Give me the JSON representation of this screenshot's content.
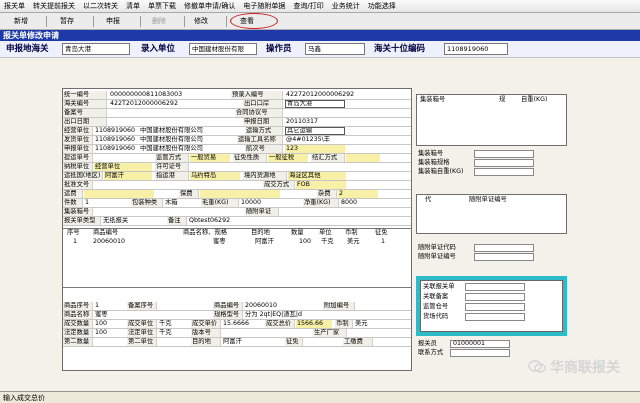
{
  "menu": [
    "报关单",
    "转关提前报关",
    "以二次转关",
    "清单",
    "单票下载",
    "修撤单申请/确认",
    "电子随附单据",
    "查询/打印",
    "业务统计",
    "功能选择"
  ],
  "toolbar": {
    "add": "新增",
    "save": "暂存",
    "declare": "申报",
    "delete": "删除",
    "modify": "修改",
    "view": "查看"
  },
  "title": "报关单修改申请",
  "header": {
    "customs_label": "申报地海关",
    "customs_value": "青岛大港",
    "unit_label": "录入单位",
    "unit_value": "中国建材股份有限",
    "operator_label": "操作员",
    "operator_value": "马鑫",
    "code_label": "海关十位编码",
    "code_value": "1108919060"
  },
  "form": {
    "unified_no_label": "统一编号",
    "unified_no": "000000000811083003",
    "pre_entry_label": "预录入编号",
    "pre_entry": "42272012000006292",
    "customs_no_label": "海关编号",
    "customs_no": "422T2012000006292",
    "exit_port_label": "出口口岸",
    "exit_port": "青岛大港",
    "record_no_label": "备案号",
    "contract_label": "合同协议号",
    "exit_date_label": "出口日期",
    "decl_date_label": "申报日期",
    "decl_date": "20110317",
    "operating_unit_label": "经营单位",
    "operating_code": "1108919060",
    "operating_name": "中国建材股份有限公司",
    "transport_label": "运输方式",
    "transport_value": "其它运输",
    "shipper_label": "发货单位",
    "shipper_code": "1108919060",
    "shipper_name": "中国建材股份有限公司",
    "tool_label": "运输工具名称",
    "tool_value": "@4#01235\\丰",
    "applicant_label": "申报单位",
    "applicant_code": "1108919060",
    "applicant_name": "中国建材股份有限公司",
    "voyage_label": "航次号",
    "voyage_value": "123",
    "loading_label": "提运单号",
    "supervision_label": "监管方式",
    "supervision_value": "一般贸易",
    "tax_nature_label": "征免性质",
    "tax_nature_value": "一般征税",
    "settlement_label": "结汇方式",
    "taxpayer_label": "纳税单位",
    "taxpayer_value": "经营单位",
    "license_label": "许可证号",
    "destination_label": "运抵国(地区)",
    "destination_value": "阿富汗",
    "port_label": "指运港",
    "port_value": "乌约特岛",
    "source_label": "境内货源地",
    "source_value": "海淀区其他",
    "approval_label": "批准文号",
    "deal_label": "成交方式",
    "deal_value": "FOB",
    "freight_label": "运费",
    "insurance_label": "保费",
    "misc_label": "杂费",
    "misc_value": "2",
    "pieces_label": "件数",
    "pieces_value": "1",
    "package_label": "包装种类",
    "package_value": "木箱",
    "gross_label": "毛重(KG)",
    "gross_value": "10000",
    "net_label": "净重(KG)",
    "net_value": "8000",
    "container_label": "集装箱号",
    "attached_label": "随附单证",
    "type_label": "报关单类型",
    "type_value": "无纸报关",
    "note_label": "备注",
    "note_value": "Qbtest06292"
  },
  "items": {
    "headers": [
      "序号",
      "商品编号",
      "商品名称、规格",
      "目的地",
      "数量",
      "单位",
      "币制",
      "征免"
    ],
    "rows": [
      {
        "no": "1",
        "code": "20060010",
        "name": "蜜枣",
        "dest": "阿富汗",
        "qty": "100",
        "unit": "千克",
        "curr": "美元",
        "tax": "1"
      }
    ]
  },
  "detail": {
    "seq_label": "商品序号",
    "seq_value": "1",
    "rec_seq_label": "备案序号",
    "code_label": "商品编号",
    "code_value": "20060010",
    "extra_label": "附加编号",
    "name_label": "商品名称",
    "name_value": "蜜枣",
    "spec_label": "规格型号",
    "spec_value": "分为 2qt|EQ|渣瓦|d",
    "qty_label": "成交数量",
    "qty_value": "100",
    "unit_label": "成交单位",
    "unit_value": "千克",
    "price_label": "成交单价",
    "price_value": "15.6666",
    "total_label": "成交总价",
    "total_value": "1566.66",
    "curr_label": "币制",
    "curr_value": "美元",
    "legal_qty_label": "法定数量",
    "legal_qty_value": "100",
    "legal_unit_label": "法定单位",
    "legal_unit_value": "千克",
    "version_label": "版本号",
    "mfr_label": "生产厂家",
    "second_qty_label": "第二数量",
    "second_unit_label": "第二单位",
    "dest_label": "目的地",
    "dest_value": "阿富汗",
    "tax_label": "征免",
    "tax_value": "",
    "duty_label": "工缴费"
  },
  "side": {
    "container_no": "集装箱号",
    "spec": "规",
    "weight": "自重(KG)",
    "side_container": "集装箱号",
    "side_container_spec": "集装箱规格",
    "side_container_weight": "集装箱自重(KG)",
    "doc_code": "代",
    "doc_no": "随附单证编号",
    "attached_code": "随附单证代码",
    "attached_no": "随附单证编号"
  },
  "decl": {
    "relation_no": "关联报关单",
    "relation_record": "关联备案",
    "supervision_place": "监管仓号",
    "yard_code": "货场代码"
  },
  "declarant": {
    "label": "报关员",
    "value": "01000001",
    "contact_label": "联系方式"
  },
  "status": "输入成交总价",
  "watermark": "华商联报关"
}
